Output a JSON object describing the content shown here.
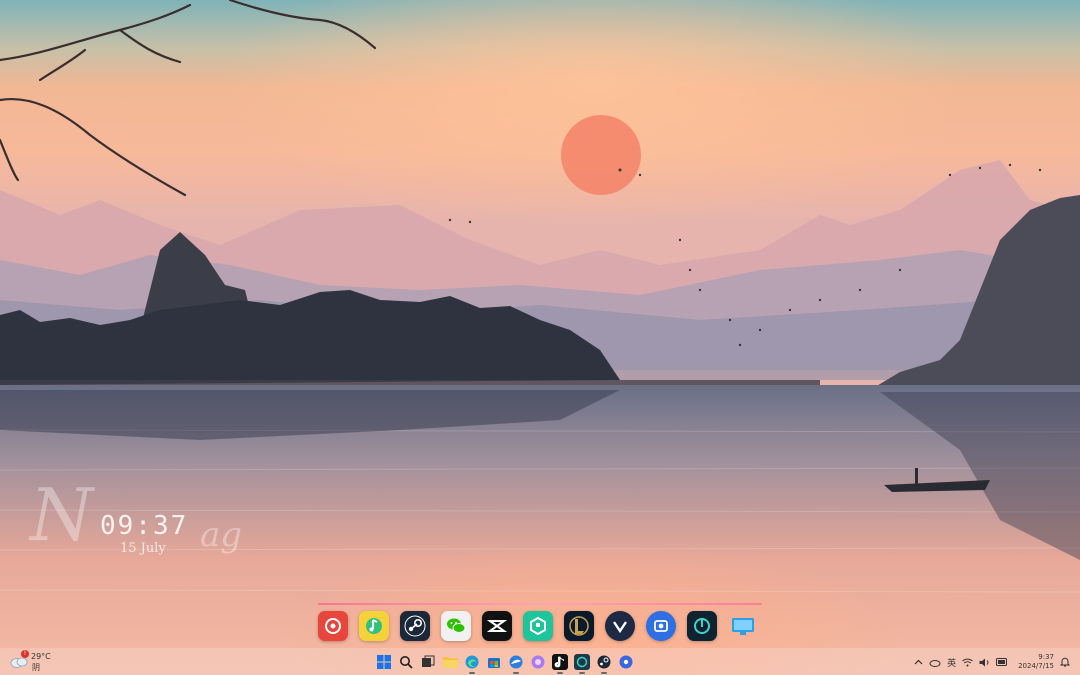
{
  "desktop": {
    "clock_widget": {
      "signature": "N",
      "signature_tail": "ag",
      "time": "09:37",
      "date": "15 July"
    }
  },
  "dock": {
    "apps": [
      {
        "name": "netease-music-icon",
        "color": "#e8453c"
      },
      {
        "name": "qq-music-icon",
        "color": "#31c27c"
      },
      {
        "name": "steam-icon",
        "color": "#1b2838"
      },
      {
        "name": "wechat-icon",
        "color": "#2dc100"
      },
      {
        "name": "capcut-icon",
        "color": "#111111"
      },
      {
        "name": "green-app-icon",
        "color": "#1fc59a"
      },
      {
        "name": "league-of-legends-icon",
        "color": "#0a1a2a"
      },
      {
        "name": "valorant-v-icon",
        "color": "#1e2a44"
      },
      {
        "name": "screenshot-app-icon",
        "color": "#2f6fe4"
      },
      {
        "name": "circle-app-icon",
        "color": "#0e2230"
      },
      {
        "name": "monitor-icon",
        "color": "#2aa0e6"
      }
    ]
  },
  "taskbar": {
    "weather": {
      "temperature": "29°C",
      "condition": "阴",
      "alert_badge": "!"
    },
    "pinned": [
      {
        "name": "start-icon"
      },
      {
        "name": "search-icon"
      },
      {
        "name": "task-view-icon"
      },
      {
        "name": "file-explorer-icon"
      },
      {
        "name": "edge-icon"
      },
      {
        "name": "store-icon"
      },
      {
        "name": "browser-icon"
      },
      {
        "name": "photos-icon"
      },
      {
        "name": "tiktok-icon"
      },
      {
        "name": "app-icon"
      },
      {
        "name": "steam-icon"
      },
      {
        "name": "disc-icon"
      }
    ],
    "tray": {
      "ime": "英",
      "time": "9:37",
      "date": "2024/7/15"
    }
  }
}
